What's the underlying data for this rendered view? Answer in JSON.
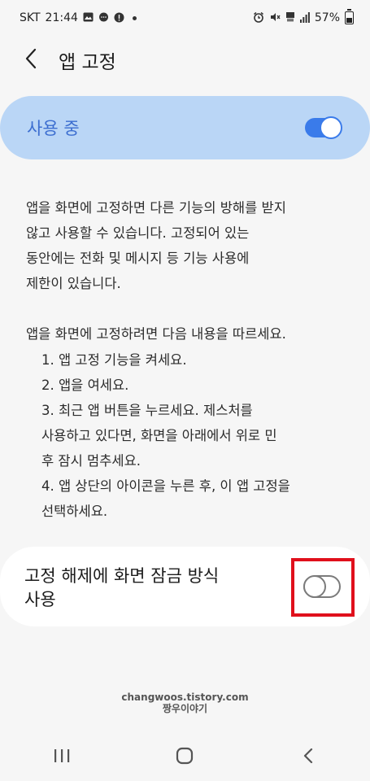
{
  "status_bar": {
    "carrier": "SKT",
    "time": "21:44",
    "battery": "57%",
    "battery_level": 0.57,
    "left_icons": [
      "gallery-icon",
      "chat-icon",
      "message-icon",
      "notification-dot"
    ],
    "right_icons": [
      "alarm-icon",
      "mute-icon",
      "volte-icon",
      "signal-icon",
      "battery-icon"
    ]
  },
  "header": {
    "back_icon": "chevron-left-icon",
    "title": "앱 고정"
  },
  "master_switch": {
    "label": "사용 중",
    "checked": true,
    "accent_color": "#3a7bea",
    "bg_color": "#bad6f6"
  },
  "description": {
    "lines": [
      "앱을 화면에 고정하면 다른 기능의 방해를 받지",
      "않고 사용할 수 있습니다. 고정되어 있는",
      "동안에는 전화 및 메시지 등 기능 사용에",
      "제한이 있습니다."
    ]
  },
  "instructions": {
    "title": "앱을 화면에 고정하려면 다음 내용을 따르세요.",
    "steps": [
      "1. 앱 고정 기능을 켜세요.",
      "2. 앱을 여세요.",
      "3. 최근 앱 버튼을 누르세요. 제스처를",
      "사용하고 있다면, 화면을 아래에서 위로 민",
      "후 잠시 멈추세요.",
      "4. 앱 상단의 아이콘을 누른 후, 이 앱 고정을",
      "선택하세요."
    ]
  },
  "lock_option": {
    "label_line1": "고정 해제에 화면 잠금 방식",
    "label_line2": "사용",
    "checked": false,
    "highlight_color": "#e0101c"
  },
  "watermark": {
    "line1": "changwoos.tistory.com",
    "line2": "짱우이야기"
  },
  "nav_bar": {
    "icons": [
      "recent-apps-icon",
      "home-icon",
      "back-icon"
    ]
  }
}
